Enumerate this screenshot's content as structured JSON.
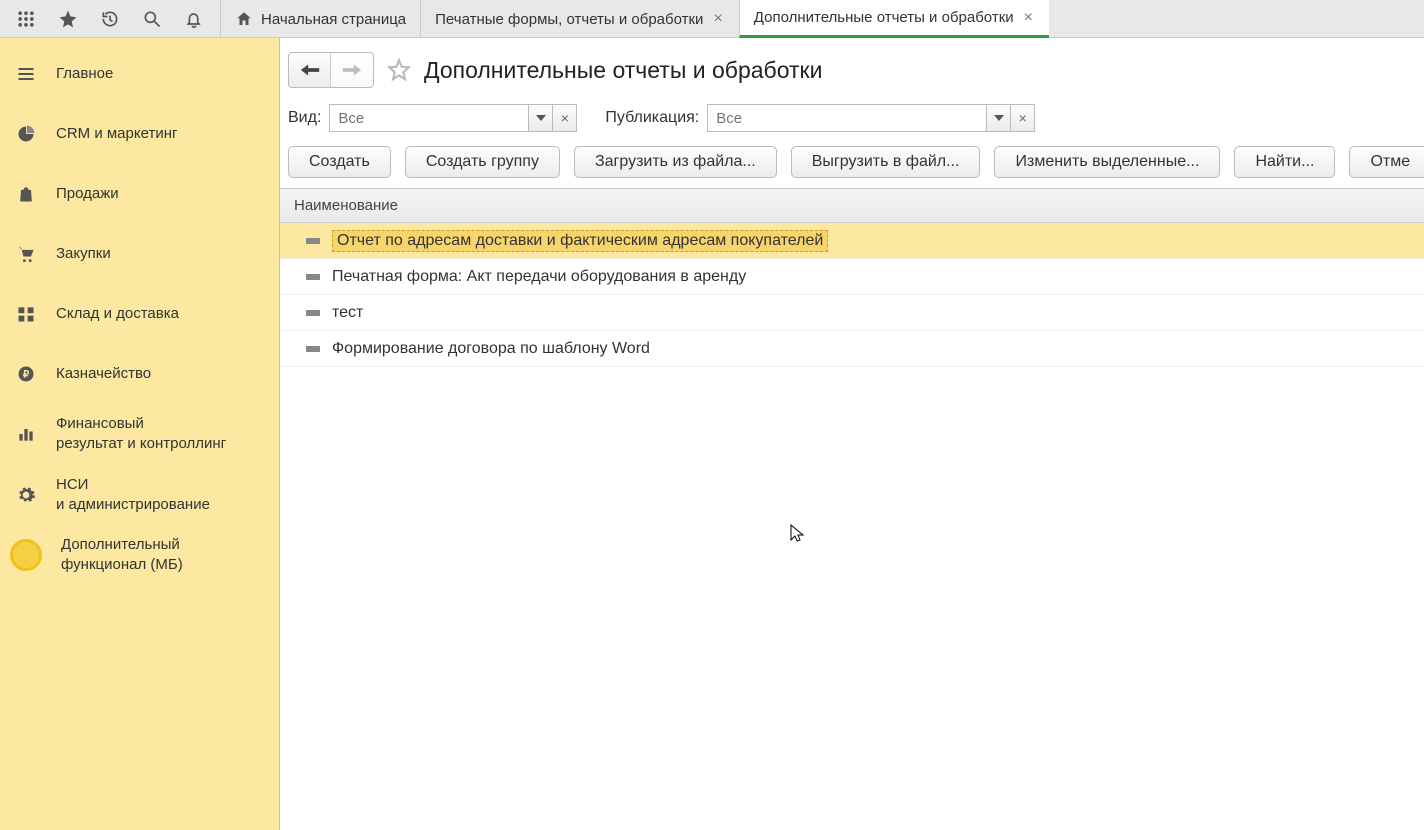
{
  "tabs": {
    "home": "Начальная страница",
    "tab1": "Печатные формы, отчеты и обработки",
    "tab2": "Дополнительные отчеты и обработки"
  },
  "sidebar": {
    "items": [
      {
        "label": "Главное"
      },
      {
        "label": "CRM и маркетинг"
      },
      {
        "label": "Продажи"
      },
      {
        "label": "Закупки"
      },
      {
        "label": "Склад и доставка"
      },
      {
        "label": "Казначейство"
      },
      {
        "label": "Финансовый\nрезультат и контроллинг"
      },
      {
        "label": "НСИ\nи администрирование"
      },
      {
        "label": "Дополнительный\nфункционал (МБ)"
      }
    ]
  },
  "page": {
    "title": "Дополнительные отчеты и обработки"
  },
  "filters": {
    "vid_label": "Вид:",
    "vid_placeholder": "Все",
    "pub_label": "Публикация:",
    "pub_placeholder": "Все"
  },
  "actions": {
    "create": "Создать",
    "create_group": "Создать группу",
    "load_file": "Загрузить из файла...",
    "export_file": "Выгрузить в файл...",
    "edit_selected": "Изменить выделенные...",
    "find": "Найти...",
    "cancel": "Отме"
  },
  "table": {
    "header": "Наименование",
    "rows": [
      {
        "name": "Отчет по адресам доставки и фактическим адресам покупателей",
        "selected": true
      },
      {
        "name": "Печатная форма: Акт передачи оборудования в аренду",
        "selected": false
      },
      {
        "name": "тест",
        "selected": false
      },
      {
        "name": "Формирование договора по шаблону Word",
        "selected": false
      }
    ]
  }
}
